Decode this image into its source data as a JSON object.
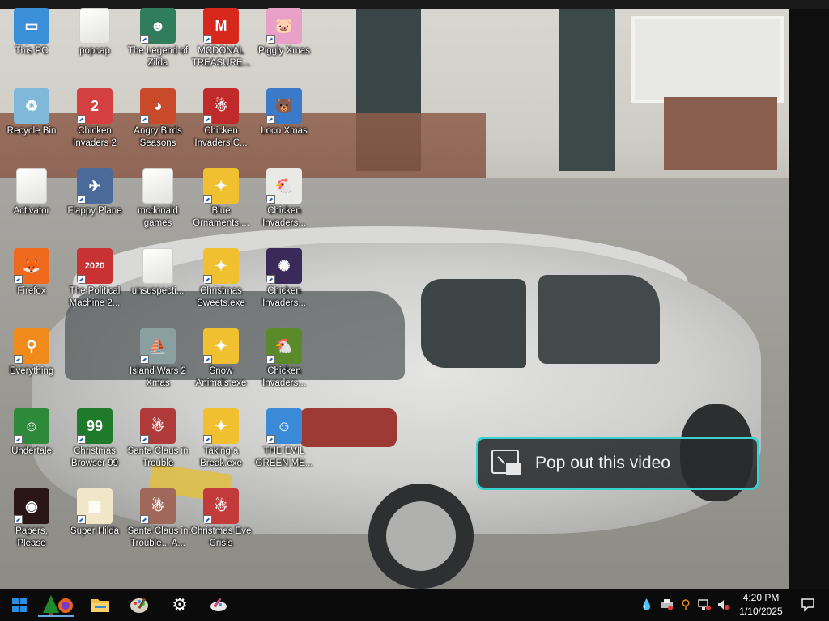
{
  "desktop": {
    "icons": [
      {
        "label": "This PC",
        "icon": "computer-icon",
        "bg": "#3a8fd8",
        "glyph": "▭",
        "shortcut": false
      },
      {
        "label": "Recycle Bin",
        "icon": "recycle-bin-icon",
        "bg": "#7fb8d8",
        "glyph": "♻",
        "shortcut": false
      },
      {
        "label": "Activator",
        "icon": "folder-icon",
        "bg": "#e9e9e6",
        "glyph": "",
        "shortcut": false
      },
      {
        "label": "Firefox",
        "icon": "firefox-icon",
        "bg": "#f06a1e",
        "glyph": "🦊",
        "shortcut": true
      },
      {
        "label": "Everything",
        "icon": "everything-search-icon",
        "bg": "#f08a1a",
        "glyph": "⚲",
        "shortcut": true
      },
      {
        "label": "Undertale",
        "icon": "undertale-icon",
        "bg": "#2e8a3a",
        "glyph": "☺",
        "shortcut": true
      },
      {
        "label": "Papers, Please",
        "icon": "papers-please-icon",
        "bg": "#2a1616",
        "glyph": "◉",
        "shortcut": true
      },
      {
        "label": "popcap",
        "icon": "folder-icon",
        "bg": "#e9e9e6",
        "glyph": "",
        "shortcut": false
      },
      {
        "label": "Chicken Invaders 2",
        "icon": "chicken-icon",
        "bg": "#d44040",
        "glyph": "2",
        "shortcut": true
      },
      {
        "label": "Flappy Plane",
        "icon": "flappy-plane-icon",
        "bg": "#4a6a9a",
        "glyph": "✈",
        "shortcut": true
      },
      {
        "label": "The Political Machine 2...",
        "icon": "political-machine-icon",
        "bg": "#c83232",
        "glyph": "2020",
        "shortcut": true
      },
      {
        "label": "",
        "icon": "",
        "bg": "",
        "glyph": "",
        "shortcut": false
      },
      {
        "label": "Christmas Browser 99",
        "icon": "christmas-tree-icon",
        "bg": "#1f7a2c",
        "glyph": "99",
        "shortcut": true
      },
      {
        "label": "Super Hilda",
        "icon": "super-hilda-icon",
        "bg": "#f2e6c8",
        "glyph": "▦",
        "shortcut": true
      },
      {
        "label": "The Legend of Zilda",
        "icon": "zilda-icon",
        "bg": "#2f7d5a",
        "glyph": "☻",
        "shortcut": true
      },
      {
        "label": "Angry Birds Seasons",
        "icon": "angry-birds-icon",
        "bg": "#c84a2a",
        "glyph": "◕",
        "shortcut": true
      },
      {
        "label": "mcdonald games",
        "icon": "folder-icon",
        "bg": "#e9e9e6",
        "glyph": "",
        "shortcut": false
      },
      {
        "label": "unsuspecti...",
        "icon": "folder-icon",
        "bg": "#e9e9e6",
        "glyph": "",
        "shortcut": false
      },
      {
        "label": "Island Wars 2 Xmas",
        "icon": "island-wars-icon",
        "bg": "#8aa0a0",
        "glyph": "⛵",
        "shortcut": true
      },
      {
        "label": "Santa Claus in Trouble",
        "icon": "santa-icon",
        "bg": "#b03a3a",
        "glyph": "☃",
        "shortcut": true
      },
      {
        "label": "Santa Claus in Trouble... A...",
        "icon": "santa-icon",
        "bg": "#a0685a",
        "glyph": "☃",
        "shortcut": true
      },
      {
        "label": "MCDONAL TREASURE...",
        "icon": "mcdonalds-icon",
        "bg": "#d8271c",
        "glyph": "M",
        "shortcut": true
      },
      {
        "label": "Chicken Invaders C...",
        "icon": "chicken-icon",
        "bg": "#c02a2a",
        "glyph": "☃",
        "shortcut": true
      },
      {
        "label": "Blue Ornaments....",
        "icon": "puzzle-icon",
        "bg": "#f0c030",
        "glyph": "✦",
        "shortcut": true
      },
      {
        "label": "Christmas Sweets.exe",
        "icon": "puzzle-icon",
        "bg": "#f0c030",
        "glyph": "✦",
        "shortcut": true
      },
      {
        "label": "Snow Animals.exe",
        "icon": "puzzle-icon",
        "bg": "#f0c030",
        "glyph": "✦",
        "shortcut": true
      },
      {
        "label": "Taking a Break.exe",
        "icon": "puzzle-icon",
        "bg": "#f0c030",
        "glyph": "✦",
        "shortcut": true
      },
      {
        "label": "Christmas Eve Crisis",
        "icon": "santa-icon",
        "bg": "#c23a3a",
        "glyph": "☃",
        "shortcut": true
      },
      {
        "label": "Piggly Xmas",
        "icon": "piggly-icon",
        "bg": "#e8a0c8",
        "glyph": "🐷",
        "shortcut": true
      },
      {
        "label": "Loco Xmas",
        "icon": "bear-icon",
        "bg": "#3a7ac8",
        "glyph": "🐻",
        "shortcut": true
      },
      {
        "label": "Chicken Invaders...",
        "icon": "chicken-icon",
        "bg": "#e9e9e6",
        "glyph": "🐔",
        "shortcut": true
      },
      {
        "label": "Chicken Invaders...",
        "icon": "chicken-icon",
        "bg": "#3a2a5a",
        "glyph": "✺",
        "shortcut": true
      },
      {
        "label": "Chicken Invaders...",
        "icon": "chicken-icon",
        "bg": "#5a8a2a",
        "glyph": "🐔",
        "shortcut": true
      },
      {
        "label": "THE EVIL GREEN ME...",
        "icon": "messenger-icon",
        "bg": "#3a8ad8",
        "glyph": "☺",
        "shortcut": true
      }
    ]
  },
  "popout": {
    "label": "Pop out this video"
  },
  "taskbar": {
    "items": [
      {
        "name": "start-button",
        "icon": "windows-icon"
      },
      {
        "name": "christmas-browser-taskbar-button",
        "icon": "christmas-tree-icon"
      },
      {
        "name": "file-explorer-taskbar-button",
        "icon": "folder-icon"
      },
      {
        "name": "paint-taskbar-button",
        "icon": "paint-palette-icon"
      },
      {
        "name": "settings-taskbar-button",
        "icon": "gear-icon"
      },
      {
        "name": "paint-app-taskbar-button",
        "icon": "paint-brush-icon"
      }
    ],
    "clock": {
      "time": "4:20 PM",
      "date": "1/10/2025"
    }
  }
}
